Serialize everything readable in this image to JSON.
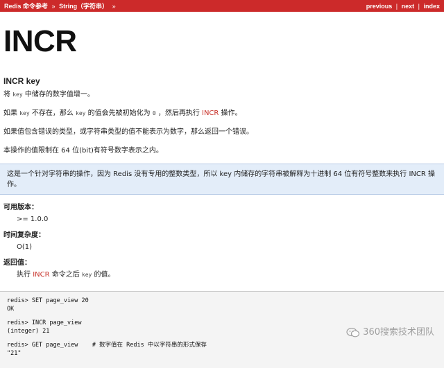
{
  "topbar": {
    "crumb_root": "Redis 命令参考",
    "crumb_sep1": "»",
    "crumb_section": "String（字符串）",
    "crumb_sep2": "»",
    "nav_previous": "previous",
    "nav_next": "next",
    "nav_index": "index",
    "nav_sep": "|"
  },
  "page": {
    "title": "INCR",
    "signature": "INCR key",
    "p1": {
      "t1": "将 ",
      "code1": "key",
      "t2": " 中储存的数字值增一。"
    },
    "p2": {
      "t1": "如果 ",
      "code1": "key",
      "t2": " 不存在，那么 ",
      "code2": "key",
      "t3": " 的值会先被初始化为 ",
      "code3": "0",
      "t4": " ，然后再执行 ",
      "link": "INCR",
      "t5": " 操作。"
    },
    "p3": "如果值包含错误的类型，或字符串类型的值不能表示为数字，那么返回一个错误。",
    "p4": "本操作的值限制在 64 位(bit)有符号数字表示之内。",
    "note": "这是一个针对字符串的操作，因为 Redis 没有专用的整数类型，所以 key 内储存的字符串被解释为十进制 64 位有符号整数来执行 INCR 操作。"
  },
  "meta": {
    "version_label": "可用版本：",
    "version_value": ">= 1.0.0",
    "complexity_label": "时间复杂度：",
    "complexity_value": "O(1)",
    "return_label": "返回值：",
    "return_t1": "执行 ",
    "return_link": "INCR",
    "return_t2": " 命令之后 ",
    "return_code": "key",
    "return_t3": " 的值。"
  },
  "code_example": {
    "l1": "redis> SET page_view 20",
    "l2": "OK",
    "l3": "redis> INCR page_view",
    "l4": "(integer) 21",
    "l5": "redis> GET page_view    # 数字值在 Redis 中以字符串的形式保存",
    "l6": "\"21\""
  },
  "watermark": {
    "text": "360搜索技术团队",
    "icon": "wechat-icon"
  },
  "colors": {
    "topbar_bg": "#cc2a2a",
    "link_red": "#c8322a",
    "note_bg": "#e3edf9",
    "code_bg": "#f4f4f4"
  }
}
